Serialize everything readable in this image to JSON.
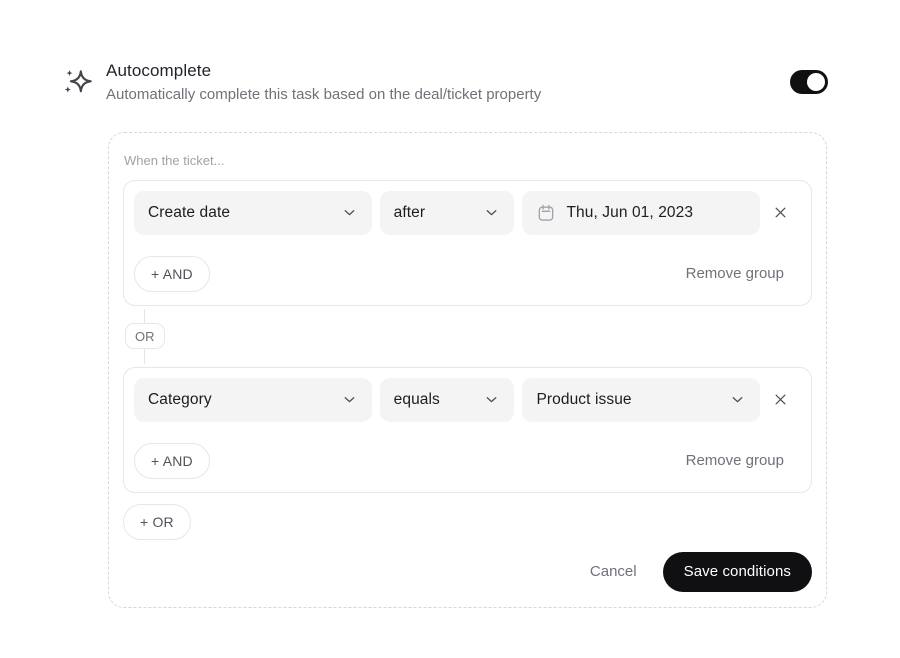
{
  "header": {
    "title": "Autocomplete",
    "subtitle": "Automatically complete this task based on the deal/ticket property",
    "toggle": {
      "state": "on"
    }
  },
  "builder": {
    "intro_label": "When the ticket...",
    "groups": [
      {
        "conditions": [
          {
            "property": "Create date",
            "operator": "after",
            "value": "Thu, Jun 01, 2023",
            "value_kind": "date"
          }
        ],
        "and_label": "+ AND",
        "remove_group_label": "Remove group"
      },
      {
        "conditions": [
          {
            "property": "Category",
            "operator": "equals",
            "value": "Product issue",
            "value_kind": "select"
          }
        ],
        "and_label": "+ AND",
        "remove_group_label": "Remove group"
      }
    ],
    "connector_label": "OR",
    "add_group_label": "+ OR",
    "footer": {
      "cancel_label": "Cancel",
      "save_label": "Save conditions"
    }
  },
  "icons": {
    "sparkles": "sparkles-icon",
    "calendar": "calendar-icon",
    "chevron_down": "chevron-down-icon",
    "close": "close-icon"
  },
  "colors": {
    "accent_black": "#101012",
    "field_bg": "#f4f4f5",
    "border_light": "#e7e7ea",
    "dashed_border": "#d6d6db",
    "text_primary": "#1c1c21",
    "text_secondary": "#71717a",
    "text_muted": "#a1a1aa"
  }
}
